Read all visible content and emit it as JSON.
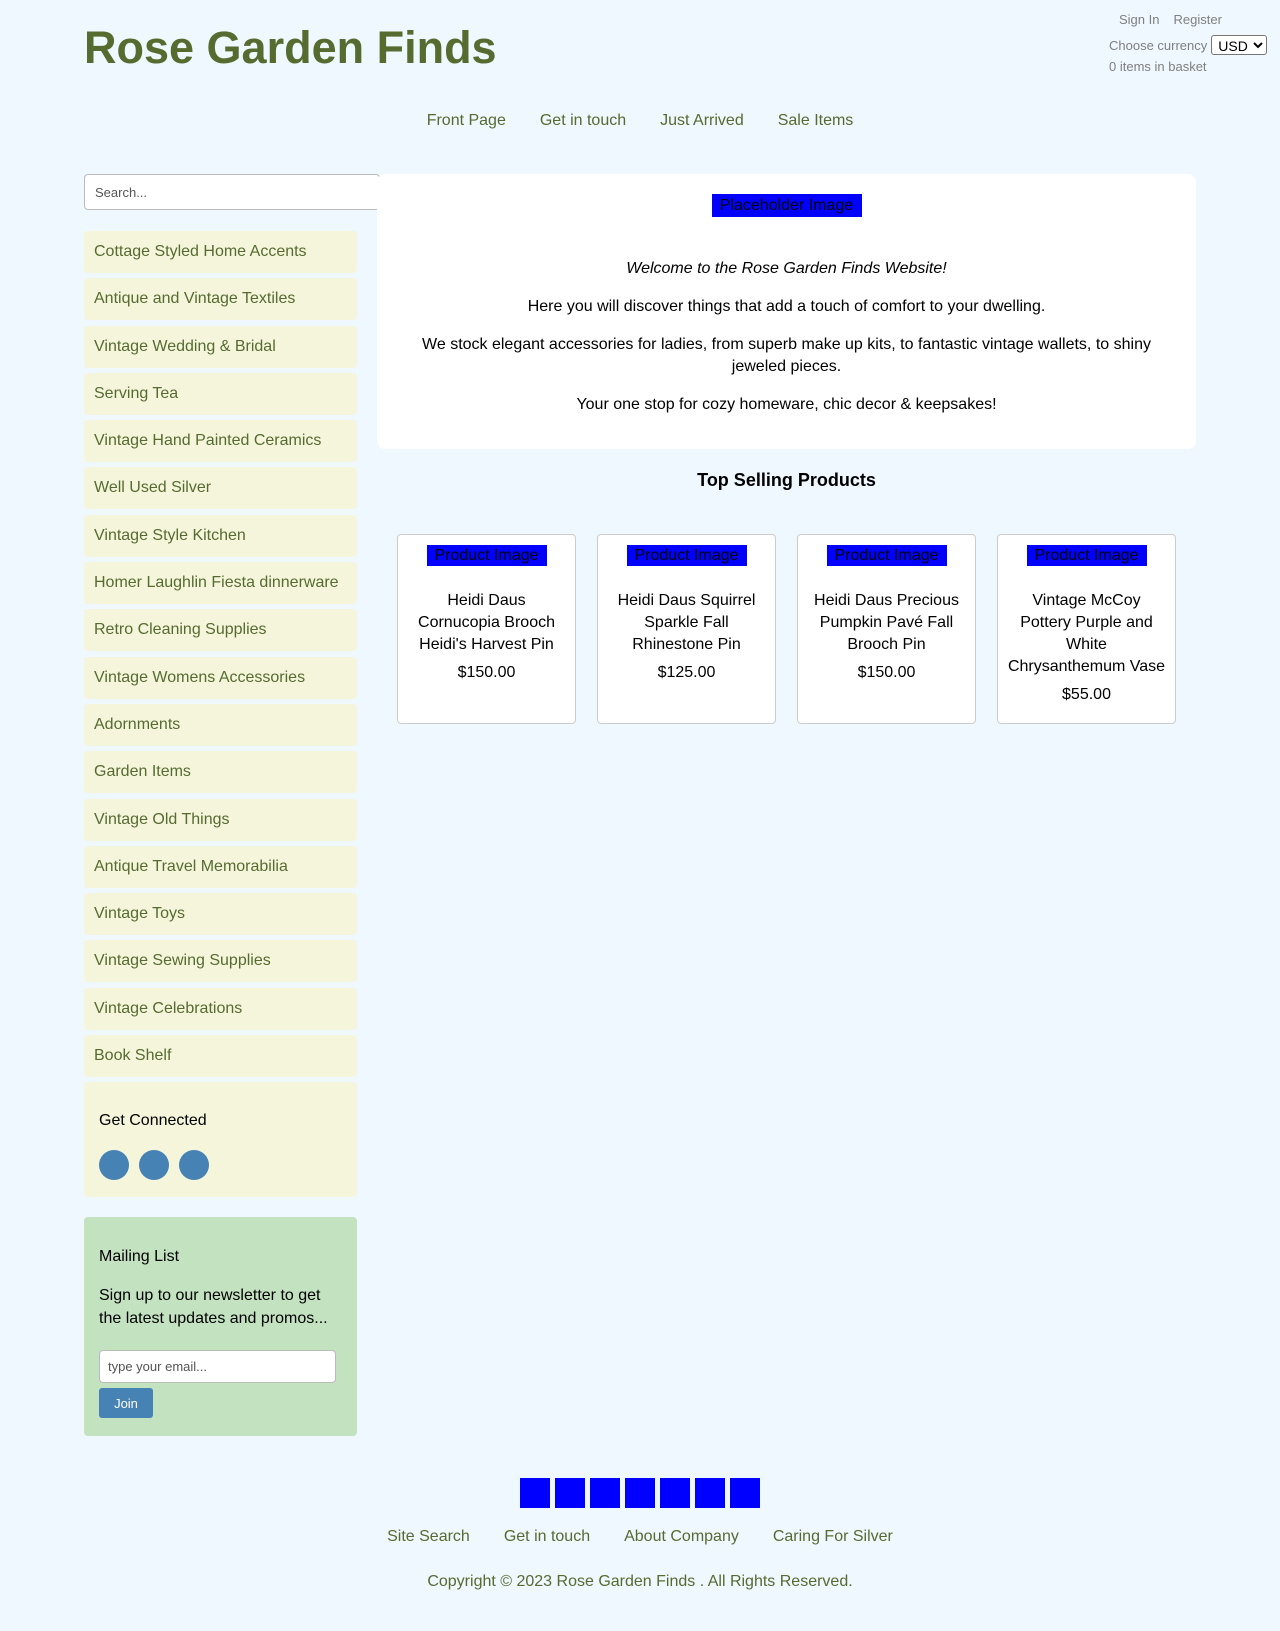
{
  "header": {
    "site_title": "Rose Garden Finds",
    "sign_in": "Sign In",
    "register": "Register",
    "currency_label": "Choose currency",
    "currency_value": "USD",
    "basket_text": "0 items in basket"
  },
  "nav": [
    "Front Page",
    "Get in touch",
    "Just Arrived",
    "Sale Items"
  ],
  "search": {
    "placeholder": "Search..."
  },
  "categories": [
    "Cottage Styled Home Accents",
    "Antique and Vintage Textiles",
    "Vintage Wedding & Bridal",
    "Serving Tea",
    "Vintage Hand Painted Ceramics",
    "Well Used Silver",
    "Vintage Style Kitchen",
    "Homer Laughlin Fiesta dinnerware",
    "Retro Cleaning Supplies",
    "Vintage Womens Accessories",
    "Adornments",
    "Garden Items",
    "Vintage Old Things",
    "Antique Travel Memorabilia",
    "Vintage Toys",
    "Vintage Sewing Supplies",
    "Vintage Celebrations",
    "Book Shelf"
  ],
  "connected": {
    "title": "Get Connected",
    "icons": [
      "social-icon-1",
      "social-icon-2",
      "social-icon-3"
    ]
  },
  "mailing": {
    "title": "Mailing List",
    "text": "Sign up to our newsletter to get the latest updates and promos...",
    "placeholder": "type your email...",
    "button": "Join"
  },
  "welcome": {
    "image_alt": "Placeholder Image",
    "heading": "Welcome to the Rose Garden Finds Website!",
    "lines": [
      "Here you will discover things that add a touch of comfort to your dwelling.",
      "We stock elegant accessories for ladies, from superb make up kits, to fantastic vintage wallets, to shiny jeweled pieces.",
      "Your one stop for cozy homeware, chic decor & keepsakes!"
    ]
  },
  "top_selling": {
    "title": "Top Selling Products",
    "products": [
      {
        "image_alt": "Product Image",
        "name": "Heidi Daus Cornucopia Brooch Heidi's Harvest Pin",
        "price": "$150.00"
      },
      {
        "image_alt": "Product Image",
        "name": "Heidi Daus Squirrel Sparkle Fall Rhinestone Pin",
        "price": "$125.00"
      },
      {
        "image_alt": "Product Image",
        "name": "Heidi Daus Precious Pumpkin Pavé Fall Brooch Pin",
        "price": "$150.00"
      },
      {
        "image_alt": "Product Image",
        "name": "Vintage McCoy Pottery Purple and White Chrysanthemum Vase",
        "price": "$55.00"
      }
    ]
  },
  "footer": {
    "payment_icon_count": 7,
    "links": [
      "Site Search",
      "Get in touch",
      "About Company",
      "Caring For Silver"
    ],
    "copyright": "Copyright © 2023 Rose Garden Finds . All Rights Reserved."
  },
  "colors": {
    "background": "#eff7ff",
    "brand_green": "#556b2f",
    "category_bg": "#f5f5dc",
    "mailing_bg": "#c2e2c0",
    "accent_blue": "#4682b4",
    "placeholder_blue": "#0000ff"
  }
}
